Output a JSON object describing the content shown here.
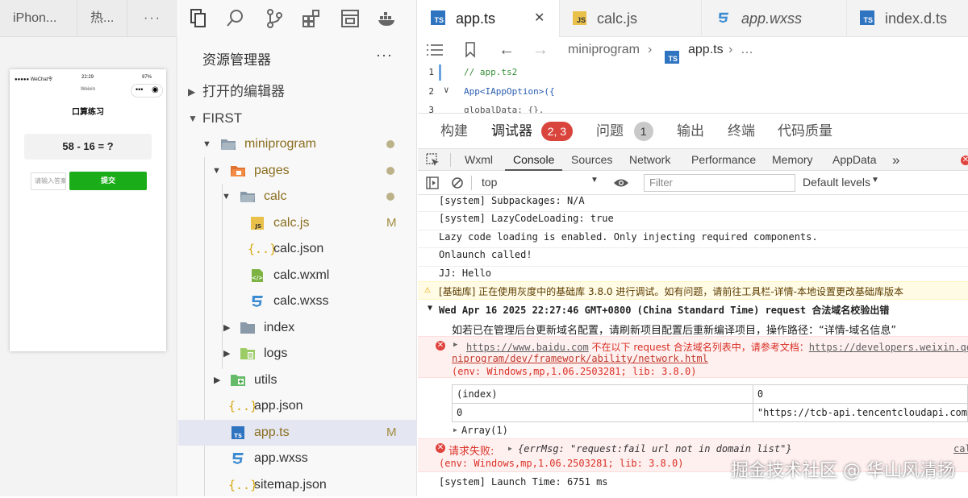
{
  "simulator": {
    "tabs": [
      "iPhon...",
      "热...",
      "···"
    ],
    "status_left": "●●●●● WeChat令",
    "status_time": "22:29",
    "status_battery": "97%",
    "nav_sub": "Weixin",
    "capsule_more": "•••",
    "capsule_close": "◉",
    "page_title": "口算练习",
    "question": "58 - 16 = ?",
    "input_placeholder": "请输入答案",
    "submit_label": "提交"
  },
  "explorer": {
    "title": "资源管理器",
    "more": "···",
    "sections": {
      "open_editors": "打开的编辑器",
      "workspace": "FIRST"
    },
    "tree": {
      "miniprogram": "miniprogram",
      "pages": "pages",
      "calc": "calc",
      "calc_js": "calc.js",
      "calc_js_status": "M",
      "calc_json": "calc.json",
      "calc_wxml": "calc.wxml",
      "calc_wxss": "calc.wxss",
      "index": "index",
      "logs": "logs",
      "utils": "utils",
      "app_json": "app.json",
      "app_ts": "app.ts",
      "app_ts_status": "M",
      "app_wxss": "app.wxss",
      "sitemap_json": "sitemap.json"
    }
  },
  "editor": {
    "tabs": [
      {
        "label": "app.ts",
        "badge": "TS"
      },
      {
        "label": "calc.js",
        "badge": "JS"
      },
      {
        "label": "app.wxss",
        "badge": ""
      },
      {
        "label": "index.d.ts",
        "badge": "TS"
      }
    ],
    "close_glyph": "✕",
    "breadcrumb": [
      "miniprogram",
      "app.ts",
      "…"
    ],
    "code": [
      {
        "n": "1",
        "text": "// app.ts2"
      },
      {
        "n": "2",
        "text": "App<IAppOption>({"
      },
      {
        "n": "3",
        "text": "  globalData: {},"
      }
    ]
  },
  "panel": {
    "tabs": [
      "构建",
      "调试器",
      "问题",
      "输出",
      "终端",
      "代码质量"
    ],
    "debugger_badge": "2, 3",
    "problems_badge": "1"
  },
  "devtools": {
    "tabs": [
      "Wxml",
      "Console",
      "Sources",
      "Network",
      "Performance",
      "Memory",
      "AppData"
    ],
    "more": "»",
    "context": "top",
    "filter_placeholder": "Filter",
    "levels": "Default levels"
  },
  "console": {
    "l1": "[system] Subpackages: N/A",
    "l2": "[system] LazyCodeLoading: true",
    "l3": "Lazy code loading is enabled. Only injecting required components.",
    "l4": "Onlaunch called!",
    "l5": "JJ:  Hello",
    "warn": "[基础库] 正在使用灰度中的基础库 3.8.0 进行调试。如有问题，请前往工具栏-详情-本地设置更改基础库版本",
    "group_title_time": "Wed Apr 16 2025 22:27:46 GMT+0800 (China Standard Time) request ",
    "group_title_cn": "合法域名校验出错",
    "group_hint": "如若已在管理后台更新域名配置，请刷新项目配置后重新编译项目，操作路径：“详情-域名信息”",
    "err1_url": "https://www.baidu.com",
    "err1_mid": " 不在以下 request 合法域名列表中，请参考文档：",
    "err1_doc": "https://developers.weixin.qq.com/miniprogram/dev/framework/ability/network.html",
    "err1_doc_cont": "niprogram/dev/framework/ability/network.html",
    "err1_env": "(env: Windows,mp,1.06.2503281; lib: 3.8.0)",
    "table_h1": "(index)",
    "table_h2": "0",
    "table_r1": "0",
    "table_r2": "\"https://tcb-api.tencentcloudapi.com",
    "array": "Array(1)",
    "err2_label": "请求失败:",
    "err2_obj": "{errMsg: \"request:fail url not in domain list\"}",
    "err2_src": "cal",
    "err2_env": "(env: Windows,mp,1.06.2503281; lib: 3.8.0)",
    "launch": "[system] Launch Time: 6751 ms"
  },
  "watermark": "掘金技术社区 @ 华山风清扬"
}
